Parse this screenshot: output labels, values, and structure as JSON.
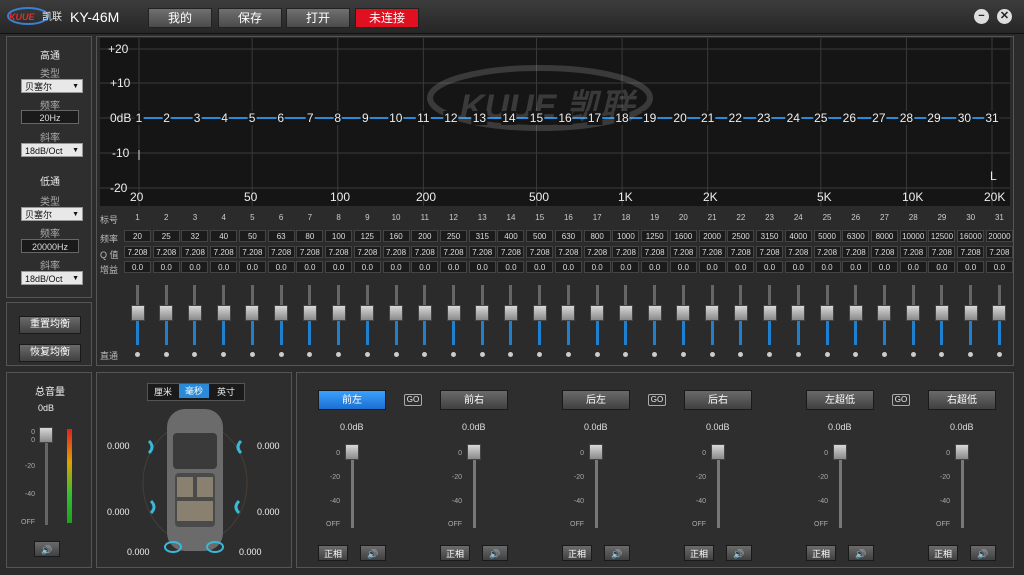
{
  "app": {
    "model": "KY-46M",
    "logo_text": "KUUE 凯联"
  },
  "toolbar": {
    "mine": "我的",
    "save": "保存",
    "open": "打开",
    "status": "未连接"
  },
  "window": {
    "minimize": "−",
    "close": "✕"
  },
  "highpass": {
    "title": "高通",
    "type_label": "类型",
    "type_value": "贝塞尔",
    "freq_label": "频率",
    "freq_value": "20Hz",
    "slope_label": "斜率",
    "slope_value": "18dB/Oct"
  },
  "lowpass": {
    "title": "低通",
    "type_label": "类型",
    "type_value": "贝塞尔",
    "freq_label": "频率",
    "freq_value": "20000Hz",
    "slope_label": "斜率",
    "slope_value": "18dB/Oct"
  },
  "eq_buttons": {
    "reset": "重置均衡",
    "restore": "恢复均衡"
  },
  "graph": {
    "y_labels": [
      "+20",
      "+10",
      "0dB",
      "-10",
      "-20"
    ],
    "x_labels": [
      "20",
      "50",
      "100",
      "200",
      "500",
      "1K",
      "2K",
      "5K",
      "10K",
      "20K"
    ],
    "right_marker": "L",
    "line_color": "#2a8ad8"
  },
  "table": {
    "row_labels": {
      "index": "标号",
      "freq": "频率",
      "q": "Q 值",
      "gain": "增益"
    },
    "bypass_label": "直通",
    "bands": [
      "1",
      "2",
      "3",
      "4",
      "5",
      "6",
      "7",
      "8",
      "9",
      "10",
      "11",
      "12",
      "13",
      "14",
      "15",
      "16",
      "17",
      "18",
      "19",
      "20",
      "21",
      "22",
      "23",
      "24",
      "25",
      "26",
      "27",
      "28",
      "29",
      "30",
      "31"
    ],
    "freqs": [
      "20",
      "25",
      "32",
      "40",
      "50",
      "63",
      "80",
      "100",
      "125",
      "160",
      "200",
      "250",
      "315",
      "400",
      "500",
      "630",
      "800",
      "1000",
      "1250",
      "1600",
      "2000",
      "2500",
      "3150",
      "4000",
      "5000",
      "6300",
      "8000",
      "10000",
      "12500",
      "16000",
      "20000"
    ],
    "q": "7.208",
    "gain": "0.0"
  },
  "master": {
    "title": "总音量",
    "value": "0dB",
    "ticks": [
      "0",
      "0",
      "-20",
      "-40",
      "OFF"
    ]
  },
  "delay": {
    "units": [
      "厘米",
      "毫秒",
      "英寸"
    ],
    "selected_unit": "毫秒",
    "fl": "0.000",
    "fr": "0.000",
    "rl": "0.000",
    "rr": "0.000",
    "sl": "0.000",
    "sr": "0.000"
  },
  "channels": [
    {
      "name": "前左",
      "gain": "0.0dB",
      "phase": "正相",
      "active": true
    },
    {
      "name": "前右",
      "gain": "0.0dB",
      "phase": "正相",
      "active": false
    },
    {
      "name": "后左",
      "gain": "0.0dB",
      "phase": "正相",
      "active": false
    },
    {
      "name": "后右",
      "gain": "0.0dB",
      "phase": "正相",
      "active": false
    },
    {
      "name": "左超低",
      "gain": "0.0dB",
      "phase": "正相",
      "active": false
    },
    {
      "name": "右超低",
      "gain": "0.0dB",
      "phase": "正相",
      "active": false
    }
  ],
  "channel_ticks": [
    "0",
    "-20",
    "-40",
    "OFF"
  ],
  "link_icon": "GO"
}
